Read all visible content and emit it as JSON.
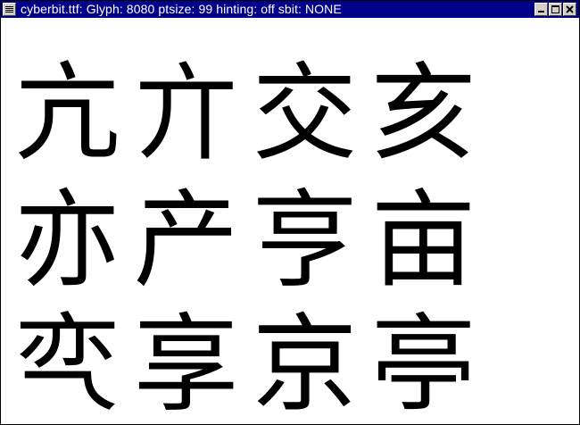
{
  "titlebar": {
    "title": "cyberbit.ttf:   Glyph: 8080  ptsize:   99  hinting: off  sbit: NONE",
    "icons": {
      "menu": "window-menu-icon",
      "minimize": "minimize-icon",
      "maximize": "maximize-icon",
      "close": "close-icon"
    }
  },
  "colors": {
    "titlebar_bg": "#000088",
    "titlebar_text": "#ffffff",
    "canvas_bg": "#ffffff",
    "glyph_color": "#000000",
    "button_face": "#d4d0c8"
  },
  "glyphs": {
    "rows": [
      [
        "亢",
        "亣",
        "交",
        "亥"
      ],
      [
        "亦",
        "产",
        "亨",
        "亩"
      ],
      [
        "亪",
        "享",
        "京",
        "亭"
      ]
    ]
  }
}
